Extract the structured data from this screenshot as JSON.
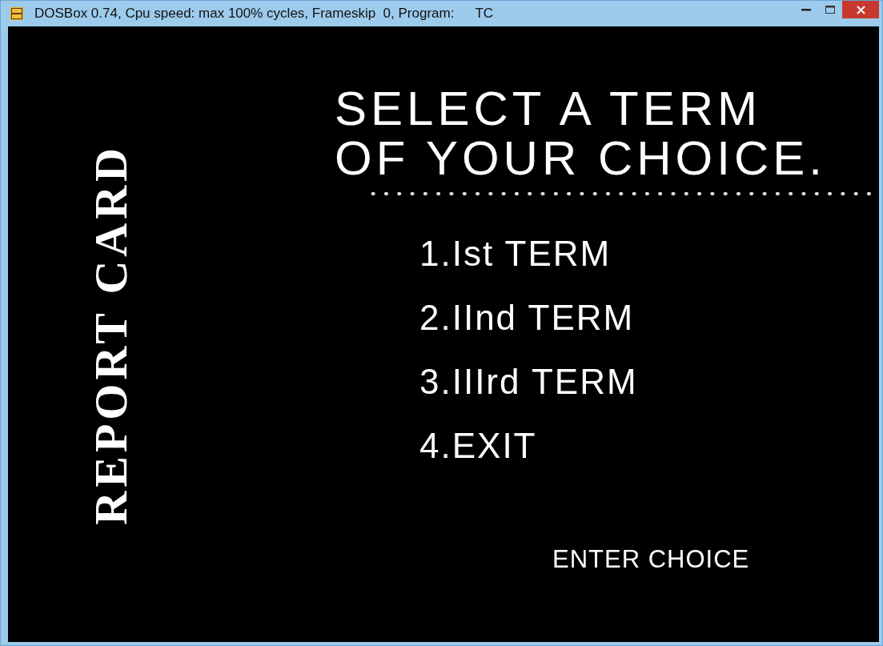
{
  "window": {
    "title": "DOSBox 0.74, Cpu speed: max 100% cycles, Frameskip  0, Program:",
    "program": "TC"
  },
  "side_title": "REPORT CARD",
  "heading": [
    "SELECT A TERM",
    "OF YOUR CHOICE."
  ],
  "menu": [
    "1.Ist TERM",
    "2.IInd TERM",
    "3.IIIrd TERM",
    "4.EXIT"
  ],
  "prompt": "ENTER CHOICE"
}
